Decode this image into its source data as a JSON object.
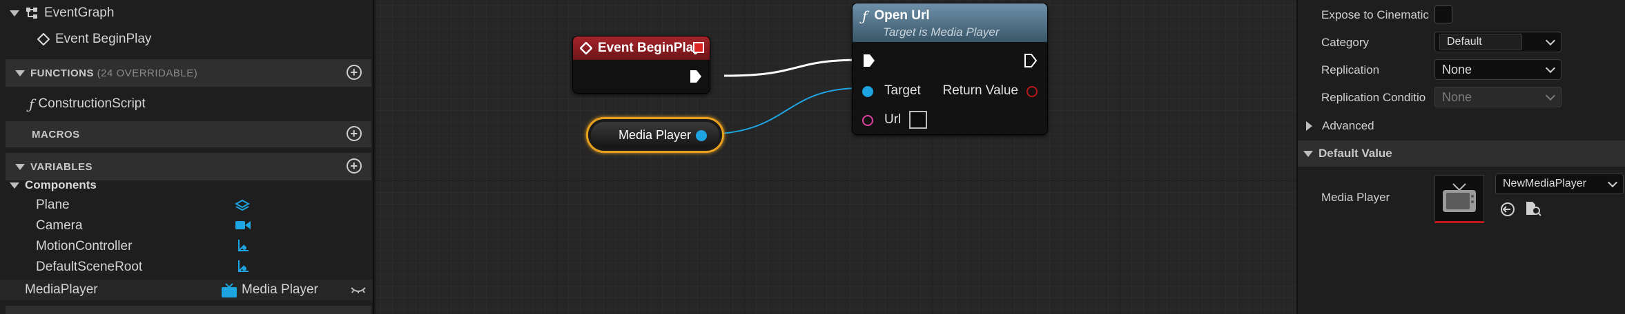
{
  "left": {
    "event_graph": "EventGraph",
    "event_beginplay": "Event BeginPlay",
    "functions_label": "FUNCTIONS",
    "functions_count": "(24 OVERRIDABLE)",
    "construction_script": "ConstructionScript",
    "macros_label": "MACROS",
    "variables_label": "VARIABLES",
    "components_label": "Components",
    "components": [
      "Plane",
      "Camera",
      "MotionController",
      "DefaultSceneRoot"
    ],
    "mediaplayer_var": "MediaPlayer",
    "mediaplayer_type": "Media Player"
  },
  "graph": {
    "begin_node_title": "Event BeginPlay",
    "media_player_node": "Media Player",
    "openurl_title": "Open Url",
    "openurl_subtitle": "Target is Media Player",
    "pin_target": "Target",
    "pin_return": "Return Value",
    "pin_url": "Url"
  },
  "right": {
    "expose_label": "Expose to Cinematic",
    "category_label": "Category",
    "category_value": "Default",
    "replication_label": "Replication",
    "replication_value": "None",
    "replication_cond_label": "Replication Conditio",
    "replication_cond_value": "None",
    "advanced_label": "Advanced",
    "default_value_label": "Default Value",
    "media_player_label": "Media Player",
    "media_player_asset": "NewMediaPlayer"
  },
  "colors": {
    "exec_pin": "#ffffff",
    "object_pin": "#1ea4e0",
    "event_header": "#8e1b1f",
    "function_header": "#5a7f96",
    "string_pin": "#e040a0"
  }
}
